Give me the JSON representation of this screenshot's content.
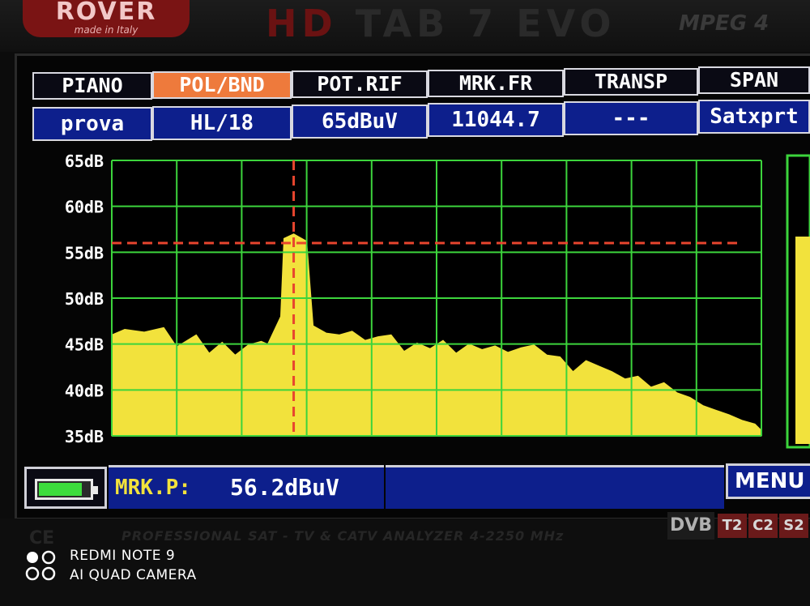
{
  "device": {
    "brand": "ROVER",
    "brand_tagline": "made in Italy",
    "model_prefix": "HD",
    "model_name": "TAB 7 EVO",
    "mpeg": "MPEG 4",
    "tagline": "PROFESSIONAL SAT - TV & CATV ANALYZER  4-2250 MHz",
    "ce_mark": "CE",
    "dvb_logo": "DVB",
    "dvb_systems": [
      "T2",
      "C2",
      "S2"
    ]
  },
  "header": {
    "columns": [
      {
        "label": "PIANO",
        "value": "prova",
        "active": false
      },
      {
        "label": "POL/BND",
        "value": "HL/18",
        "active": true
      },
      {
        "label": "POT.RIF",
        "value": "65dBuV",
        "active": false
      },
      {
        "label": "MRK.FR",
        "value": "11044.7",
        "active": false
      },
      {
        "label": "TRANSP",
        "value": "---",
        "active": false
      },
      {
        "label": "SPAN",
        "value": "Satxprt",
        "active": false
      }
    ]
  },
  "chart_data": {
    "type": "area",
    "ylabel_unit": "dB",
    "y_ticks": [
      "65dB",
      "60dB",
      "55dB",
      "50dB",
      "45dB",
      "40dB",
      "35dB"
    ],
    "ylim": [
      35,
      65
    ],
    "xlim": [
      0,
      10
    ],
    "grid": true,
    "fill_color": "#f2e23c",
    "grid_color": "#3cd43c",
    "marker_color": "#e8452e",
    "marker_x": 2.8,
    "marker_level": 56,
    "x": [
      0,
      0.2,
      0.5,
      0.8,
      1.0,
      1.3,
      1.5,
      1.7,
      1.9,
      2.1,
      2.3,
      2.4,
      2.6,
      2.65,
      2.8,
      3.0,
      3.1,
      3.3,
      3.5,
      3.7,
      3.9,
      4.1,
      4.3,
      4.5,
      4.7,
      4.9,
      5.1,
      5.3,
      5.5,
      5.7,
      5.9,
      6.1,
      6.3,
      6.5,
      6.7,
      6.9,
      7.1,
      7.3,
      7.5,
      7.7,
      7.9,
      8.1,
      8.3,
      8.5,
      8.7,
      8.9,
      9.1,
      9.3,
      9.5,
      9.7,
      9.9,
      10.0
    ],
    "values": [
      46,
      46.6,
      46.3,
      46.8,
      44.7,
      46,
      44,
      45.2,
      43.8,
      44.9,
      45.3,
      45,
      48,
      56.5,
      57,
      56.2,
      47,
      46.2,
      46,
      46.4,
      45.4,
      45.8,
      46,
      44.2,
      45.1,
      44.5,
      45.4,
      44,
      45,
      44.4,
      44.8,
      44.1,
      44.6,
      44.9,
      43.8,
      43.6,
      42,
      43.2,
      42.6,
      42,
      41.2,
      41.5,
      40.3,
      40.8,
      39.7,
      39.2,
      38.3,
      37.8,
      37.3,
      36.7,
      36.3,
      35.6
    ]
  },
  "status": {
    "battery_level": 0.85,
    "marker_label": "MRK.P:",
    "marker_value": "56.2dBuV",
    "menu_label": "MENU &"
  },
  "watermark": {
    "line1": "REDMI NOTE 9",
    "line2": "AI QUAD CAMERA"
  }
}
